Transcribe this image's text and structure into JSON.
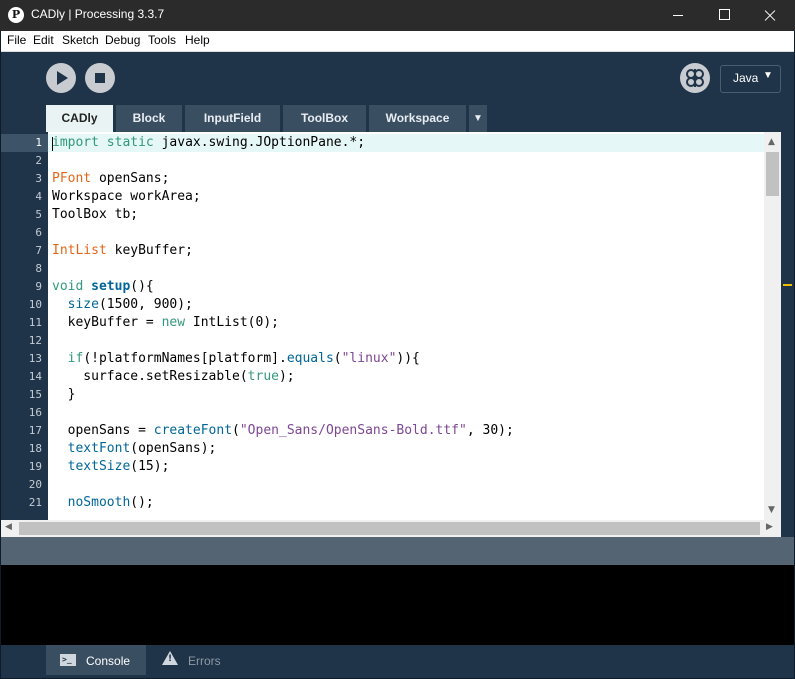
{
  "window": {
    "app_icon_letter": "P",
    "title": "CADly | Processing 3.3.7"
  },
  "menubar": {
    "items": [
      "File",
      "Edit",
      "Sketch",
      "Debug",
      "Tools",
      "Help"
    ]
  },
  "toolbar": {
    "mode_label": "Java",
    "mode_arrow": "▼",
    "debugger_icon": "butterfly-icon"
  },
  "tabs": [
    {
      "label": "CADly",
      "active": true
    },
    {
      "label": "Block",
      "active": false
    },
    {
      "label": "InputField",
      "active": false
    },
    {
      "label": "ToolBox",
      "active": false
    },
    {
      "label": "Workspace",
      "active": false
    }
  ],
  "tab_overflow": "▼",
  "editor": {
    "current_line": 1,
    "lines": [
      {
        "n": "1",
        "parts": [
          {
            "c": "kw",
            "t": "import"
          },
          {
            "c": "",
            "t": " "
          },
          {
            "c": "kw",
            "t": "static"
          },
          {
            "c": "",
            "t": " javax.swing.JOptionPane.*;"
          }
        ]
      },
      {
        "n": "2",
        "parts": []
      },
      {
        "n": "3",
        "parts": [
          {
            "c": "ty",
            "t": "PFont"
          },
          {
            "c": "",
            "t": " openSans;"
          }
        ]
      },
      {
        "n": "4",
        "parts": [
          {
            "c": "",
            "t": "Workspace workArea;"
          }
        ]
      },
      {
        "n": "5",
        "parts": [
          {
            "c": "",
            "t": "ToolBox tb;"
          }
        ]
      },
      {
        "n": "6",
        "parts": []
      },
      {
        "n": "7",
        "parts": [
          {
            "c": "ty",
            "t": "IntList"
          },
          {
            "c": "",
            "t": " keyBuffer;"
          }
        ]
      },
      {
        "n": "8",
        "parts": []
      },
      {
        "n": "9",
        "parts": [
          {
            "c": "kw",
            "t": "void"
          },
          {
            "c": "",
            "t": " "
          },
          {
            "c": "fnb",
            "t": "setup"
          },
          {
            "c": "",
            "t": "(){"
          }
        ]
      },
      {
        "n": "10",
        "parts": [
          {
            "c": "",
            "t": "  "
          },
          {
            "c": "fn",
            "t": "size"
          },
          {
            "c": "",
            "t": "(1500, 900);"
          }
        ]
      },
      {
        "n": "11",
        "parts": [
          {
            "c": "",
            "t": "  keyBuffer = "
          },
          {
            "c": "kw",
            "t": "new"
          },
          {
            "c": "",
            "t": " IntList(0);"
          }
        ]
      },
      {
        "n": "12",
        "parts": []
      },
      {
        "n": "13",
        "parts": [
          {
            "c": "",
            "t": "  "
          },
          {
            "c": "kw",
            "t": "if"
          },
          {
            "c": "",
            "t": "(!platformNames[platform]."
          },
          {
            "c": "fn",
            "t": "equals"
          },
          {
            "c": "",
            "t": "("
          },
          {
            "c": "str",
            "t": "\"linux\""
          },
          {
            "c": "",
            "t": ")){"
          }
        ]
      },
      {
        "n": "14",
        "parts": [
          {
            "c": "",
            "t": "    surface.setResizable("
          },
          {
            "c": "lit",
            "t": "true"
          },
          {
            "c": "",
            "t": ");"
          }
        ]
      },
      {
        "n": "15",
        "parts": [
          {
            "c": "",
            "t": "  }"
          }
        ]
      },
      {
        "n": "16",
        "parts": []
      },
      {
        "n": "17",
        "parts": [
          {
            "c": "",
            "t": "  openSans = "
          },
          {
            "c": "fn",
            "t": "createFont"
          },
          {
            "c": "",
            "t": "("
          },
          {
            "c": "str",
            "t": "\"Open_Sans/OpenSans-Bold.ttf\""
          },
          {
            "c": "",
            "t": ", 30);"
          }
        ]
      },
      {
        "n": "18",
        "parts": [
          {
            "c": "",
            "t": "  "
          },
          {
            "c": "fn",
            "t": "textFont"
          },
          {
            "c": "",
            "t": "(openSans);"
          }
        ]
      },
      {
        "n": "19",
        "parts": [
          {
            "c": "",
            "t": "  "
          },
          {
            "c": "fn",
            "t": "textSize"
          },
          {
            "c": "",
            "t": "(15);"
          }
        ]
      },
      {
        "n": "20",
        "parts": []
      },
      {
        "n": "21",
        "parts": [
          {
            "c": "",
            "t": "  "
          },
          {
            "c": "fn",
            "t": "noSmooth"
          },
          {
            "c": "",
            "t": "();"
          }
        ]
      }
    ]
  },
  "scrollbars": {
    "up_arrow": "▲",
    "down_arrow": "▼",
    "left_arrow": "◀",
    "right_arrow": "▶"
  },
  "footer": {
    "console_label": "Console",
    "console_icon_text": ">_",
    "errors_label": "Errors"
  },
  "colors": {
    "toolbar_bg": "#1f3349",
    "active_tab_bg": "#e9f3f3",
    "keyword": "#33997e",
    "type": "#e2661a",
    "function": "#006699",
    "string": "#7d4793"
  }
}
